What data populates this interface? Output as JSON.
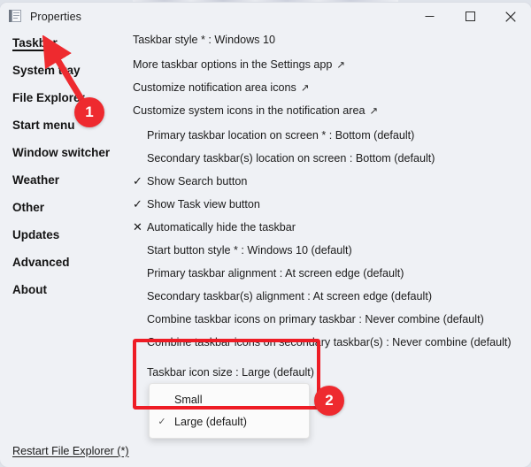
{
  "window": {
    "title": "Properties",
    "app_icon": "properties-document-icon",
    "controls": {
      "minimize": "minimize-icon",
      "maximize": "maximize-icon",
      "close": "close-icon"
    }
  },
  "sidebar": {
    "items": [
      {
        "label": "Taskbar",
        "active": true
      },
      {
        "label": "System tray",
        "active": false
      },
      {
        "label": "File Explorer",
        "active": false
      },
      {
        "label": "Start menu",
        "active": false
      },
      {
        "label": "Window switcher",
        "active": false
      },
      {
        "label": "Weather",
        "active": false
      },
      {
        "label": "Other",
        "active": false
      },
      {
        "label": "Updates",
        "active": false
      },
      {
        "label": "Advanced",
        "active": false
      },
      {
        "label": "About",
        "active": false
      }
    ]
  },
  "main": {
    "rows": [
      {
        "mark": "",
        "label": "Taskbar style * : Windows 10",
        "ext": "",
        "indent": false
      },
      {
        "mark": "",
        "label": "More taskbar options in the Settings app",
        "ext": "↗",
        "indent": false
      },
      {
        "mark": "",
        "label": "Customize notification area icons",
        "ext": "↗",
        "indent": false
      },
      {
        "mark": "",
        "label": "Customize system icons in the notification area",
        "ext": "↗",
        "indent": false
      },
      {
        "mark": "",
        "label": "Primary taskbar location on screen * : Bottom (default)",
        "ext": "",
        "indent": true
      },
      {
        "mark": "",
        "label": "Secondary taskbar(s) location on screen : Bottom (default)",
        "ext": "",
        "indent": true
      },
      {
        "mark": "✓",
        "label": "Show Search button",
        "ext": "",
        "indent": false
      },
      {
        "mark": "✓",
        "label": "Show Task view button",
        "ext": "",
        "indent": false
      },
      {
        "mark": "✕",
        "label": "Automatically hide the taskbar",
        "ext": "",
        "indent": false
      },
      {
        "mark": "",
        "label": "Start button style * : Windows 10 (default)",
        "ext": "",
        "indent": true
      },
      {
        "mark": "",
        "label": "Primary taskbar alignment : At screen edge (default)",
        "ext": "",
        "indent": true
      },
      {
        "mark": "",
        "label": "Secondary taskbar(s) alignment : At screen edge (default)",
        "ext": "",
        "indent": true
      },
      {
        "mark": "",
        "label": "Combine taskbar icons on primary taskbar : Never combine (default)",
        "ext": "",
        "indent": true
      },
      {
        "mark": "",
        "label": "Combine taskbar icons on secondary taskbar(s) : Never combine (default)",
        "ext": "",
        "indent": true
      },
      {
        "mark": "",
        "label": "Taskbar icon size : Large (default)",
        "ext": "",
        "indent": true
      }
    ]
  },
  "dropdown": {
    "name": "taskbar-icon-size-menu",
    "selected": "Large (default)",
    "check_glyph": "✓",
    "options": [
      {
        "label": "Small",
        "checked": false
      },
      {
        "label": "Large (default)",
        "checked": true
      }
    ]
  },
  "footer": {
    "restart_link": "Restart File Explorer (*)"
  },
  "annotations": {
    "badge_1": "1",
    "badge_2": "2",
    "highlight_color": "#ee1c25",
    "badge_color": "#ee2a2f"
  }
}
